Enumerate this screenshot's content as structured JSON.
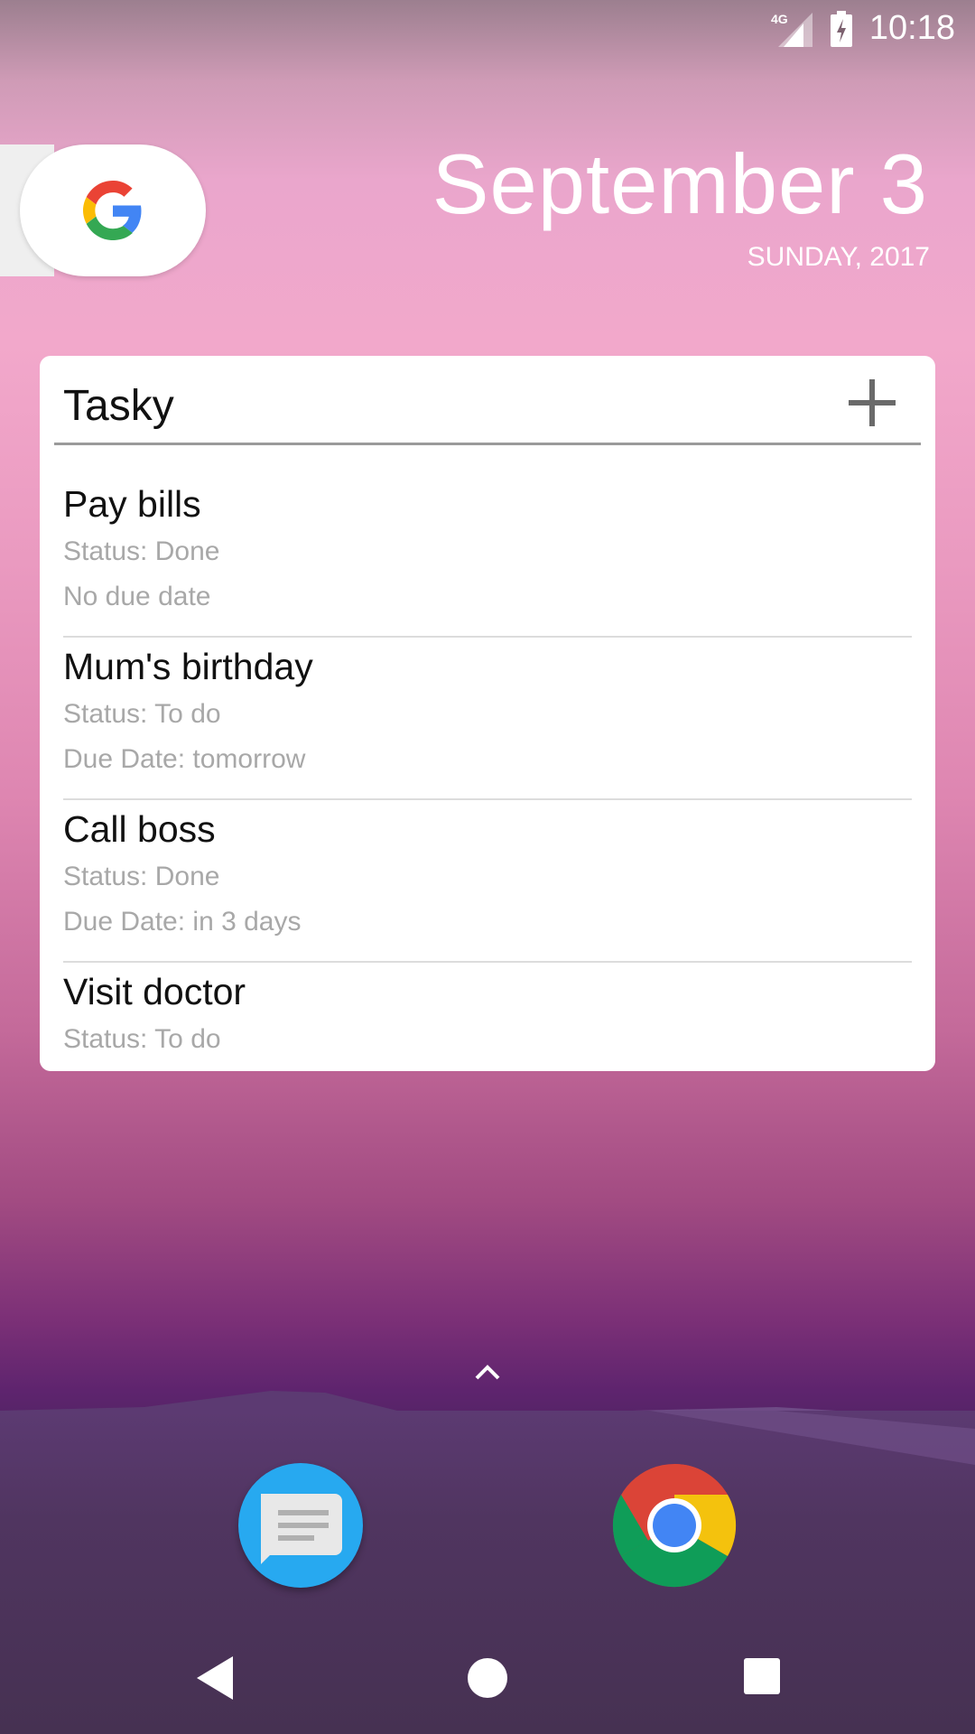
{
  "status_bar": {
    "network": "4G",
    "time": "10:18"
  },
  "date_widget": {
    "date": "September 3",
    "weekday_year": "SUNDAY, 2017"
  },
  "tasky_widget": {
    "title": "Tasky",
    "tasks": [
      {
        "title": "Pay bills",
        "status": "Status: Done",
        "due": "No due date"
      },
      {
        "title": "Mum's birthday",
        "status": "Status: To do",
        "due": "Due Date: tomorrow"
      },
      {
        "title": "Call boss",
        "status": "Status: Done",
        "due": "Due Date: in 3 days"
      },
      {
        "title": "Visit doctor",
        "status": "Status: To do",
        "due": ""
      }
    ]
  },
  "icons": {
    "google": "google-g-icon",
    "add": "plus-icon",
    "messages": "messages-app-icon",
    "chrome": "chrome-app-icon"
  },
  "colors": {
    "accent_blue": "#27a9f0",
    "widget_bg": "#ffffff",
    "secondary_text": "#a8a8a8"
  }
}
